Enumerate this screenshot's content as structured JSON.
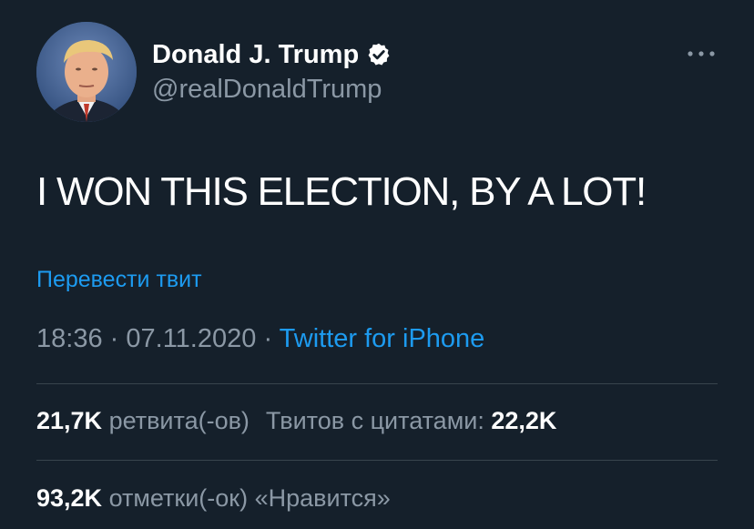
{
  "author": {
    "display_name": "Donald J. Trump",
    "handle": "@realDonaldTrump",
    "verified": true
  },
  "tweet": {
    "text": "I WON THIS ELECTION, BY A LOT!",
    "translate_label": "Перевести твит",
    "time": "18:36",
    "separator": "·",
    "date": "07.11.2020",
    "source": "Twitter for iPhone"
  },
  "stats": {
    "retweets_count": "21,7K",
    "retweets_label": "ретвита(-ов)",
    "quotes_label": "Твитов с цитатами:",
    "quotes_count": "22,2K",
    "likes_count": "93,2K",
    "likes_label": "отметки(-ок) «Нравится»"
  },
  "icons": {
    "more": "more-horizontal-icon",
    "verified": "verified-badge-icon"
  },
  "colors": {
    "background": "#15202b",
    "accent": "#1d9bf0",
    "secondary_text": "#8b98a5",
    "divider": "#38444d"
  }
}
